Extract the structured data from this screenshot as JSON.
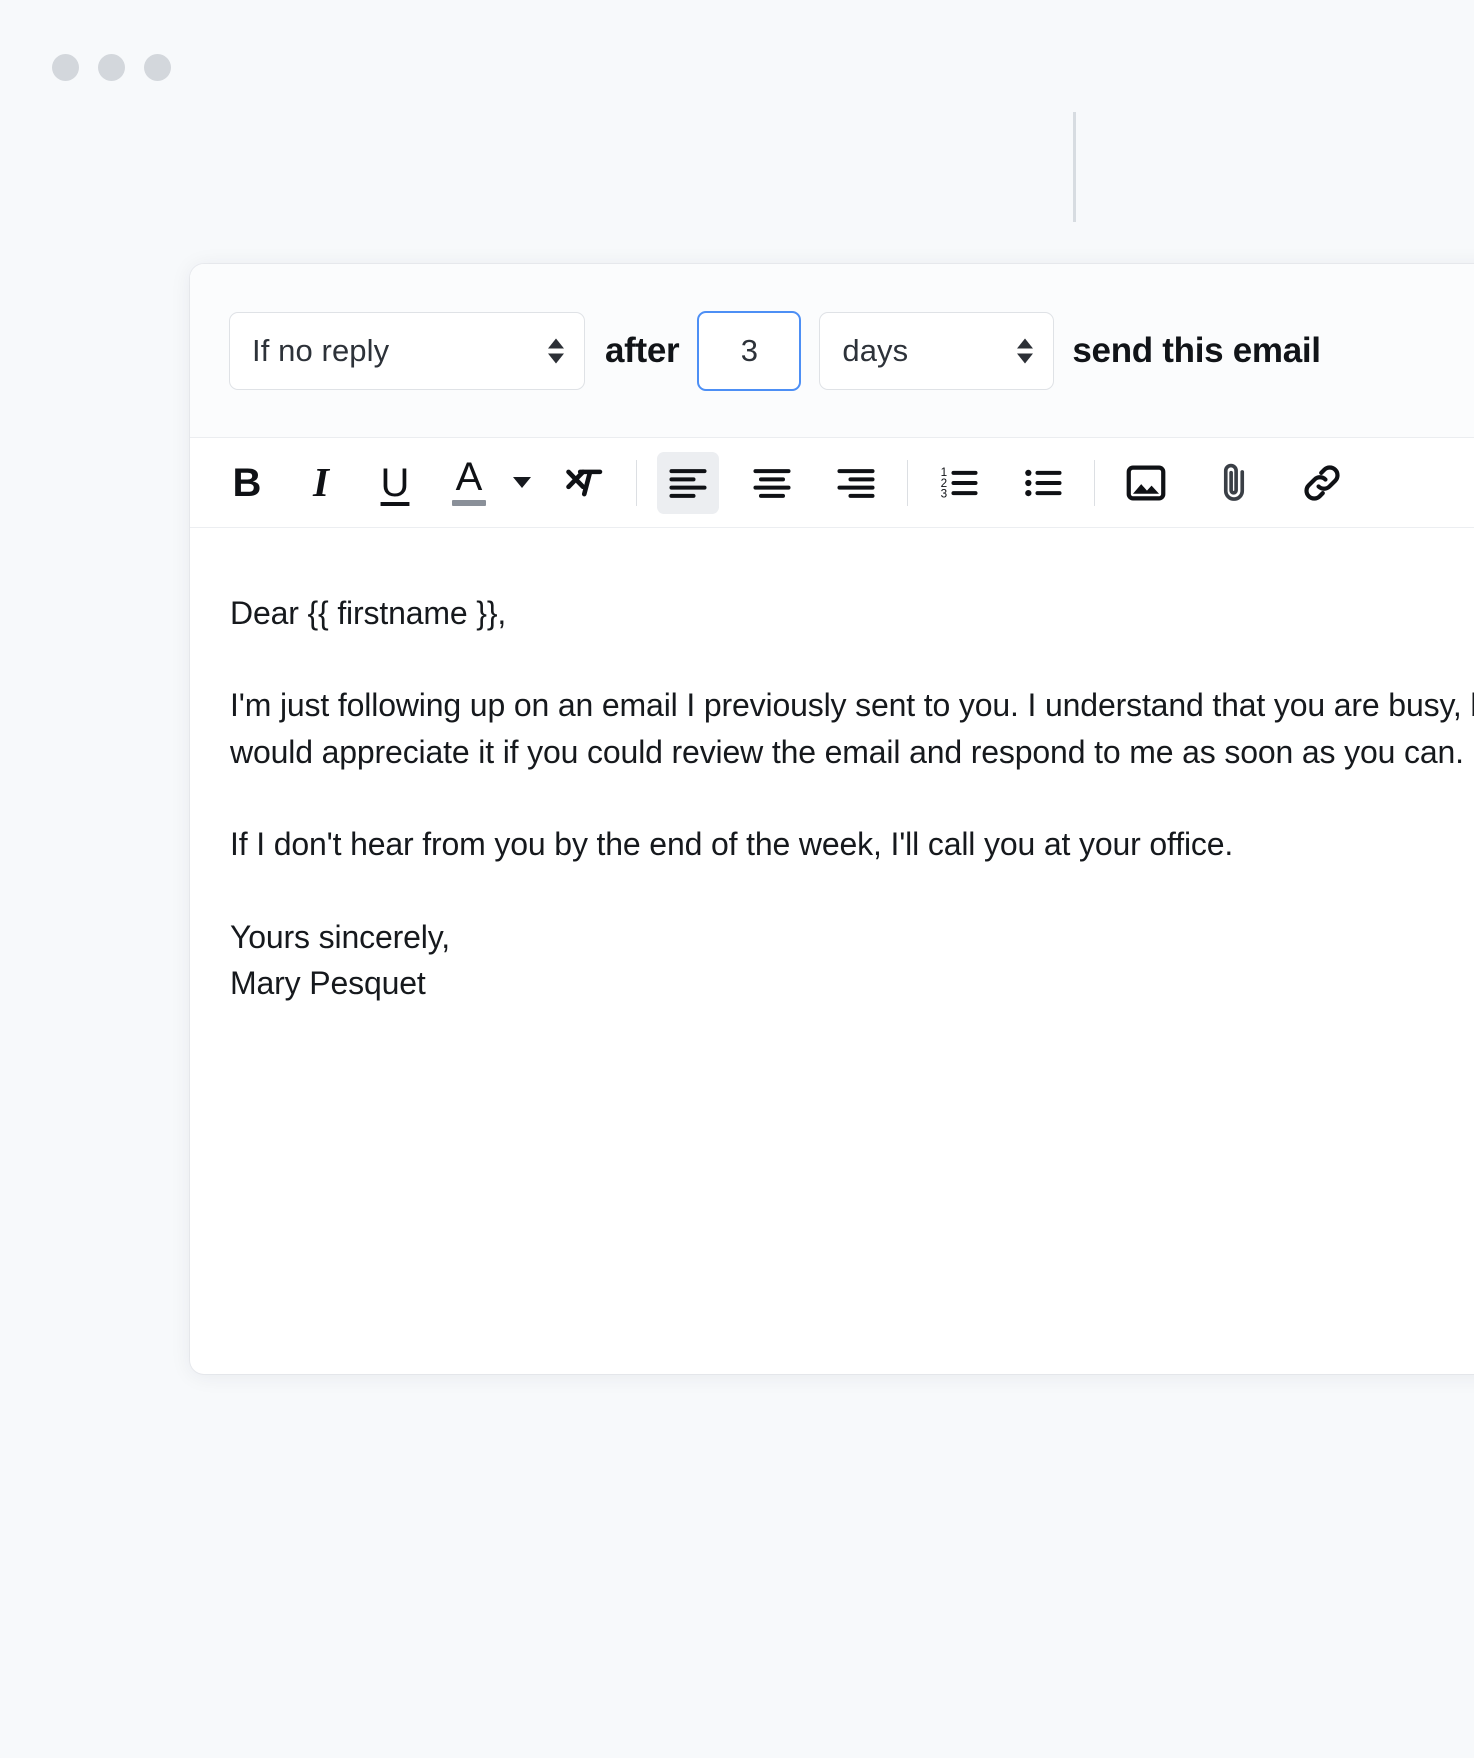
{
  "window": {
    "traffic_lights": [
      "close",
      "minimize",
      "zoom"
    ]
  },
  "condition_bar": {
    "trigger_select": {
      "value": "If no reply",
      "icon": "updown-spinner-icon"
    },
    "after_label": "after",
    "delay_value": "3",
    "unit_select": {
      "value": "days",
      "icon": "updown-spinner-icon"
    },
    "trailing_label": "send this email"
  },
  "toolbar": {
    "items": [
      {
        "name": "bold-button",
        "glyph": "B",
        "label": "Bold",
        "active": false
      },
      {
        "name": "italic-button",
        "glyph": "I",
        "label": "Italic",
        "active": false
      },
      {
        "name": "underline-button",
        "glyph": "U",
        "label": "Underline",
        "active": false
      },
      {
        "name": "text-color-button",
        "glyph": "A",
        "label": "Text color",
        "active": false
      },
      {
        "name": "text-color-dropdown",
        "glyph": "▾",
        "label": "Text color options",
        "active": false
      },
      {
        "name": "clear-formatting-button",
        "glyph": "",
        "label": "Clear formatting",
        "active": false
      },
      {
        "name": "align-left-button",
        "glyph": "",
        "label": "Align left",
        "active": true
      },
      {
        "name": "align-center-button",
        "glyph": "",
        "label": "Align center",
        "active": false
      },
      {
        "name": "align-right-button",
        "glyph": "",
        "label": "Align right",
        "active": false
      },
      {
        "name": "ordered-list-button",
        "glyph": "",
        "label": "Numbered list",
        "active": false
      },
      {
        "name": "bullet-list-button",
        "glyph": "",
        "label": "Bulleted list",
        "active": false
      },
      {
        "name": "insert-image-button",
        "glyph": "",
        "label": "Insert image",
        "active": false
      },
      {
        "name": "attach-file-button",
        "glyph": "",
        "label": "Attach file",
        "active": false
      },
      {
        "name": "insert-link-button",
        "glyph": "",
        "label": "Insert link",
        "active": false
      }
    ]
  },
  "email": {
    "greeting": "Dear {{ firstname }},",
    "paragraph_1": "I'm just following up on an email I previously sent to you. I understand that you are busy, but I would appreciate it if you could review the email and respond to me as soon as you can.",
    "paragraph_2": "If I don't hear from you by the end of the week, I'll call you at your office.",
    "signoff": "Yours sincerely,",
    "sender_name": "Mary Pesquet"
  },
  "colors": {
    "page_background": "#f7f9fb",
    "card_background": "#ffffff",
    "focus_border": "#4d8ff5",
    "traffic_light": "#d3d7dc",
    "text_primary": "#16191d",
    "active_toolbar_button": "#eceef1"
  }
}
